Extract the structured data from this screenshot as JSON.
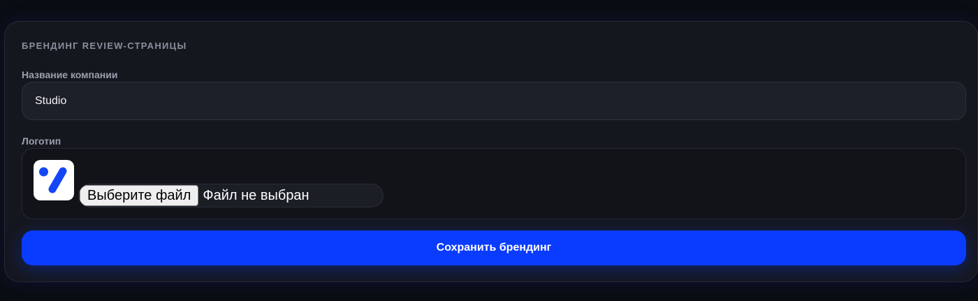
{
  "branding": {
    "section_title": "БРЕНДИНГ REVIEW-СТРАНИЦЫ",
    "company_label": "Название компании",
    "company_value": "Studio",
    "logo_label": "Логотип",
    "logo_icon": "checkmark-logo-icon",
    "file_button_label": "Выберите файл",
    "file_status": "Файл не выбран",
    "save_label": "Сохранить брендинг"
  },
  "colors": {
    "background": "#0b0d14",
    "card": "#15171f",
    "accent": "#0a3cff",
    "logo_mark": "#1546f5"
  }
}
